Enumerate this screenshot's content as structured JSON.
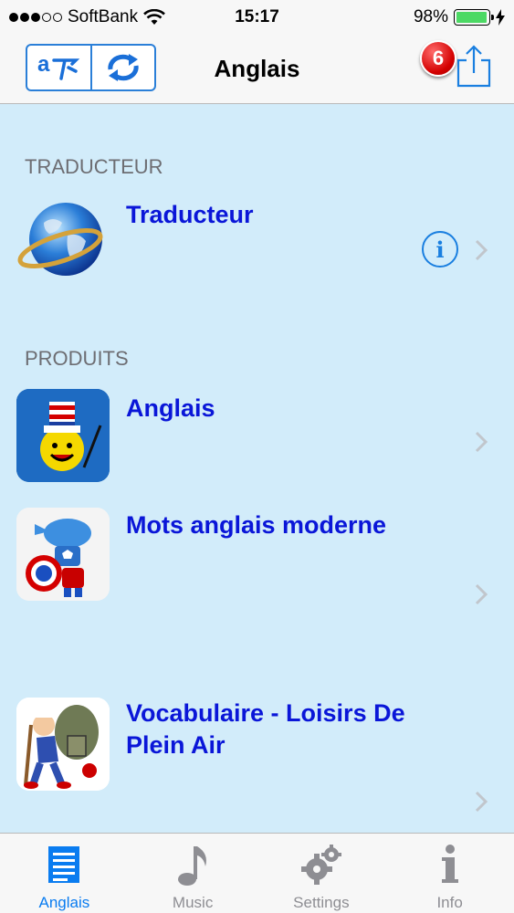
{
  "status_bar": {
    "carrier": "SoftBank",
    "time": "15:17",
    "battery": "98%",
    "signal_bars_filled": 3,
    "signal_bars_total": 5,
    "battery_level": 0.98
  },
  "nav": {
    "title": "Anglais",
    "notification_count": "6"
  },
  "sections": {
    "translator": {
      "header": "TRADUCTEUR",
      "items": [
        {
          "title": "Traducteur",
          "icon": "globe-icon"
        }
      ]
    },
    "products": {
      "header": "PRODUITS",
      "items": [
        {
          "title": "Anglais",
          "icon": "uncle-sam-smiley-app-icon"
        },
        {
          "title": "Mots anglais moderne",
          "icon": "captain-robot-app-icon"
        },
        {
          "title": "Vocabulaire - Loisirs De Plein Air",
          "icon": "hiker-app-icon"
        }
      ]
    }
  },
  "tabs": [
    {
      "label": "Anglais",
      "icon": "document-list-icon",
      "active": true
    },
    {
      "label": "Music",
      "icon": "music-note-icon",
      "active": false
    },
    {
      "label": "Settings",
      "icon": "gears-icon",
      "active": false
    },
    {
      "label": "Info",
      "icon": "info-icon",
      "active": false
    }
  ],
  "colors": {
    "accent": "#0a7cf0",
    "item_title": "#0a16d8",
    "background": "#d2ecfa",
    "badge": "#d40000"
  }
}
